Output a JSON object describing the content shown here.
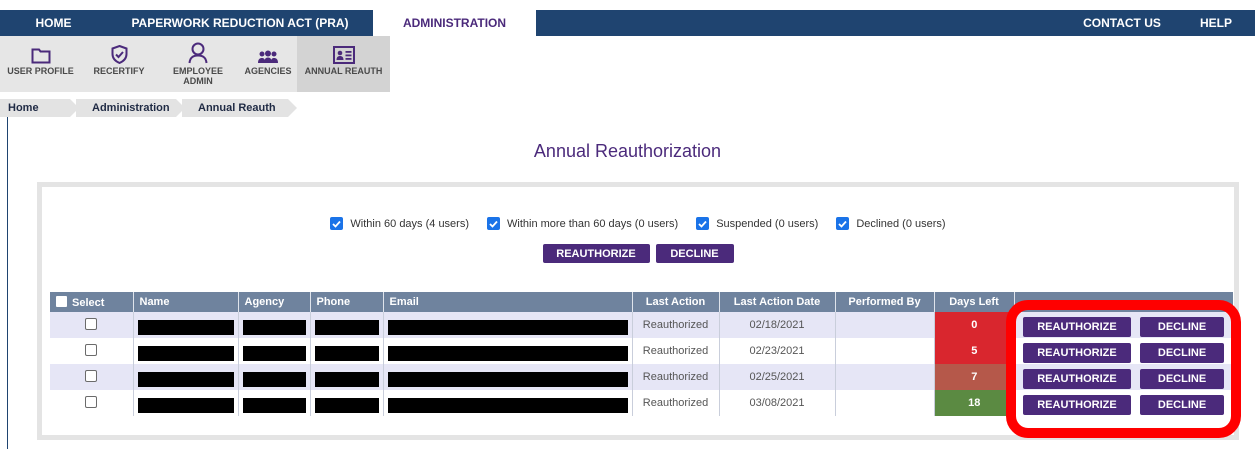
{
  "nav": {
    "home": "HOME",
    "pra": "PAPERWORK REDUCTION ACT (PRA)",
    "administration": "ADMINISTRATION",
    "contact": "CONTACT US",
    "help": "HELP"
  },
  "toolbar": {
    "user_profile": "USER PROFILE",
    "recertify": "RECERTIFY",
    "employee_admin": "EMPLOYEE ADMIN",
    "agencies": "AGENCIES",
    "annual_reauth": "ANNUAL REAUTH"
  },
  "breadcrumb": [
    "Home",
    "Administration",
    "Annual Reauth"
  ],
  "page_title": "Annual Reauthorization",
  "filters": [
    {
      "label": "Within 60 days (4 users)",
      "checked": true
    },
    {
      "label": "Within more than 60 days (0 users)",
      "checked": true
    },
    {
      "label": "Suspended (0 users)",
      "checked": true
    },
    {
      "label": "Declined (0 users)",
      "checked": true
    }
  ],
  "actions": {
    "reauthorize": "REAUTHORIZE",
    "decline": "DECLINE"
  },
  "table": {
    "headers": {
      "select": "Select",
      "name": "Name",
      "agency": "Agency",
      "phone": "Phone",
      "email": "Email",
      "last_action": "Last Action",
      "last_action_date": "Last Action Date",
      "performed_by": "Performed By",
      "days_left": "Days Left"
    },
    "rows": [
      {
        "last_action": "Reauthorized",
        "date": "02/18/2021",
        "performed_by": "",
        "days_left": "0",
        "days_color": "#d9262e"
      },
      {
        "last_action": "Reauthorized",
        "date": "02/23/2021",
        "performed_by": "",
        "days_left": "5",
        "days_color": "#d9262e"
      },
      {
        "last_action": "Reauthorized",
        "date": "02/25/2021",
        "performed_by": "",
        "days_left": "7",
        "days_color": "#b5584a"
      },
      {
        "last_action": "Reauthorized",
        "date": "03/08/2021",
        "performed_by": "",
        "days_left": "18",
        "days_color": "#5b8a42"
      }
    ]
  },
  "colors": {
    "nav_bg": "#1f4470",
    "accent_purple": "#4b2a7b",
    "table_header": "#6f839e",
    "highlight": "#ff0000"
  }
}
